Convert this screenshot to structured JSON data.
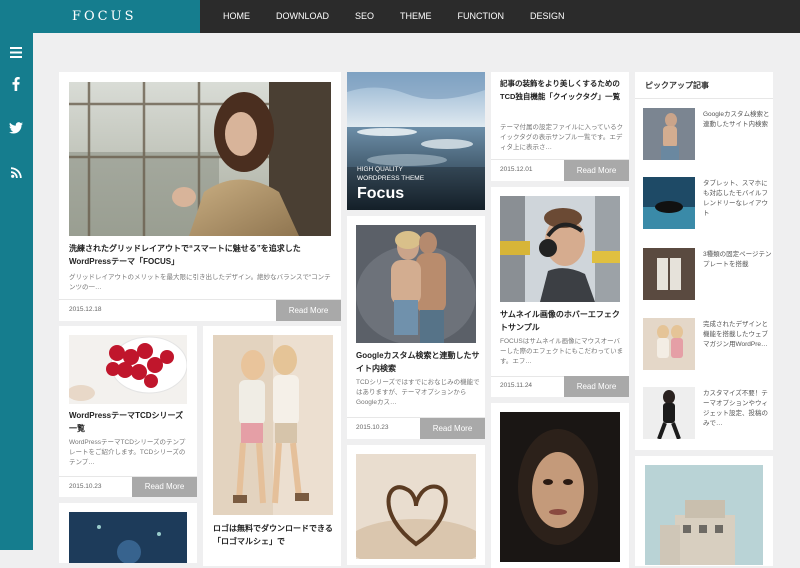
{
  "site": {
    "logo": "FOCUS"
  },
  "nav": [
    "HOME",
    "DOWNLOAD",
    "SEO",
    "THEME",
    "FUNCTION",
    "DESIGN"
  ],
  "side_icons": [
    "menu-icon",
    "facebook-icon",
    "twitter-icon",
    "rss-icon"
  ],
  "read_more": "Read More",
  "cards": {
    "c1": {
      "title": "洗練されたグリッドレイアウトで“スマートに魅せる”を追求したWordPressテーマ「FOCUS」",
      "excerpt": "グリッドレイアウトのメリットを最大限に引き出したデザイン。絶妙なバランスで“コンテンツの一…",
      "date": "2015.12.18"
    },
    "hero": {
      "small1": "HIGH QUALITY",
      "small2": "WORDPRESS THEME",
      "big": "Focus"
    },
    "c2": {
      "title": "記事の装飾をより美しくするための TCD独自機能「クイックタグ」一覧",
      "excerpt": "テーマ付属の設定ファイルに入っているクイックタグの表示サンプル一覧です。エディタ上に表示さ…",
      "date": "2015.12.01"
    },
    "c3": {
      "title": "Googleカスタム検索と連動したサイト内検索",
      "excerpt": "TCDシリーズではすでにおなじみの機能ではありますが、テーマオプションからGoogleカス…",
      "date": "2015.10.23"
    },
    "c4": {
      "title": "サムネイル画像のホバーエフェクトサンプル",
      "excerpt": "FOCUSはサムネイル画像にマウスオーバーした際のエフェクトにもこだわっています。エフ…",
      "date": "2015.11.24"
    },
    "c5": {
      "title": "WordPressテーマTCDシリーズ一覧",
      "excerpt": "WordPressテーマTCDシリーズのテンプレートをご紹介します。TCDシリーズのテンプ…",
      "date": "2015.10.23"
    },
    "c6": {
      "title": "ロゴは無料でダウンロードできる「ロゴマルシェ」で"
    }
  },
  "pickup": {
    "title": "ピックアップ記事",
    "items": [
      {
        "text": "Googleカスタム検索と連動したサイト内検索"
      },
      {
        "text": "タブレット、スマホにも対応したモバイルフレンドリーなレイアウト"
      },
      {
        "text": "3種類の固定ページテンプレートを搭載"
      },
      {
        "text": "完成されたデザインと機能を搭載したウェブマガジン用WordPre…"
      },
      {
        "text": "カスタマイズ不要！テーマオプションやウィジェット設定、投稿のみで…"
      }
    ]
  },
  "colors": {
    "brand": "#157d8e",
    "nav_bg": "#2b2b2b",
    "readmore": "#a9a9a9",
    "page_bg": "#efeff0"
  }
}
